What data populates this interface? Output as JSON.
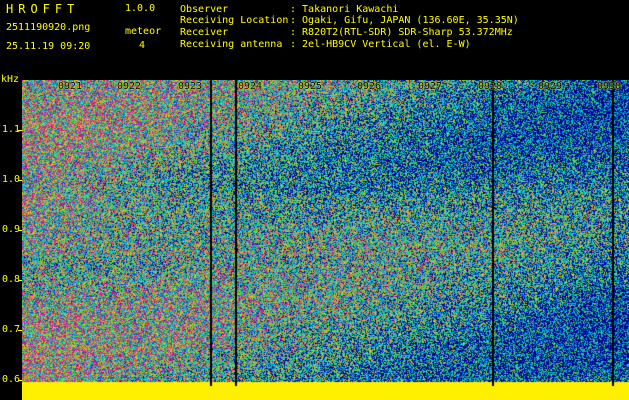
{
  "header": {
    "app_title": "HROFFT",
    "version": "1.0.0",
    "filename": "2511190920.png",
    "datetime": "25.11.19 09:20",
    "meteor_label": "meteor",
    "meteor_count": "4"
  },
  "info": [
    {
      "label": "Observer",
      "value": ": Takanori Kawachi"
    },
    {
      "label": "Receiving Location",
      "value": ": Ogaki, Gifu, JAPAN (136.60E, 35.35N)"
    },
    {
      "label": "Receiver",
      "value": ": R820T2(RTL-SDR) SDR-Sharp 53.372MHz"
    },
    {
      "label": "Receiving antenna",
      "value": ": 2el-HB9CV Vertical (el. E-W)"
    }
  ],
  "y_axis": {
    "unit": "kHz",
    "ticks": [
      "1.1",
      "1.0",
      "0.9",
      "0.8",
      "0.7",
      "0.6"
    ]
  },
  "x_axis": {
    "labels": [
      "0921",
      "0922",
      "0923",
      "0924",
      "0925",
      "0926",
      "0927",
      "0928",
      "0929",
      "0930"
    ]
  },
  "colors": {
    "label_yellow": "#ffff00",
    "background": "#000000",
    "floor_yellow": "#ffff00"
  }
}
